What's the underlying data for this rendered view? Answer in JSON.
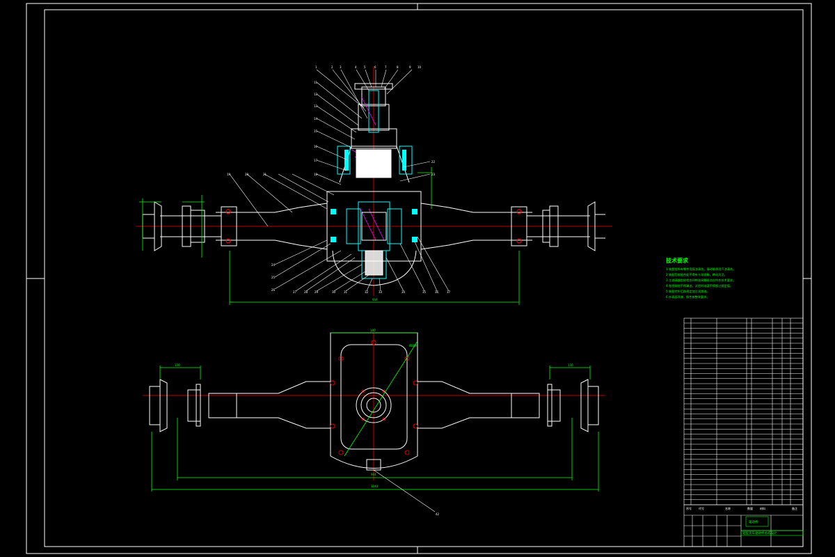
{
  "colors": {
    "background": "#000000",
    "outline": "#ffffff",
    "dimension": "#00ff00",
    "centerline": "#ff0000",
    "hidden": "#00ffff",
    "section": "#ff00ff"
  },
  "dimensions": {
    "track_top": "944",
    "track_bottom": "944",
    "bottom_overall": "1040",
    "left_flange": "130",
    "right_flange": "130",
    "housing_width": "180",
    "housing_diag": "Ø260"
  },
  "callout_labels": {
    "top_row": [
      "1",
      "2",
      "3",
      "4",
      "5",
      "6",
      "7",
      "8",
      "9",
      "10"
    ],
    "left_column": [
      "11",
      "12",
      "13",
      "14",
      "15",
      "16",
      "17",
      "18",
      "19",
      "20",
      "21"
    ],
    "right_column": [
      "22",
      "23"
    ],
    "bottom_row": [
      "24",
      "25",
      "26",
      "27",
      "28",
      "29",
      "30",
      "31",
      "32",
      "33",
      "34",
      "35",
      "36",
      "37"
    ],
    "bottom_view": "42"
  },
  "tech_notes": {
    "title": "技术要求",
    "lines": [
      "1.装配前所有零件用煤油清洗，滚动轴承用汽油清洗。",
      "2.装配后各配合处不得有卡滞现象，转动灵活。",
      "3.主减速器齿轮啮合间隙及接触斑点应符合技术要求。",
      "4.各密封处不得漏油，试验时油温不得超过规定值。",
      "5.装配完毕后按规定加注润滑油。",
      "6.外表面涂漆，颜色按整车要求。"
    ]
  },
  "title_block": {
    "drawing_name": "驱动桥",
    "sub_name": "轻型货车驱动桥总成设计",
    "headers": [
      "序号",
      "代号",
      "名称",
      "数量",
      "材料",
      "备注"
    ]
  }
}
